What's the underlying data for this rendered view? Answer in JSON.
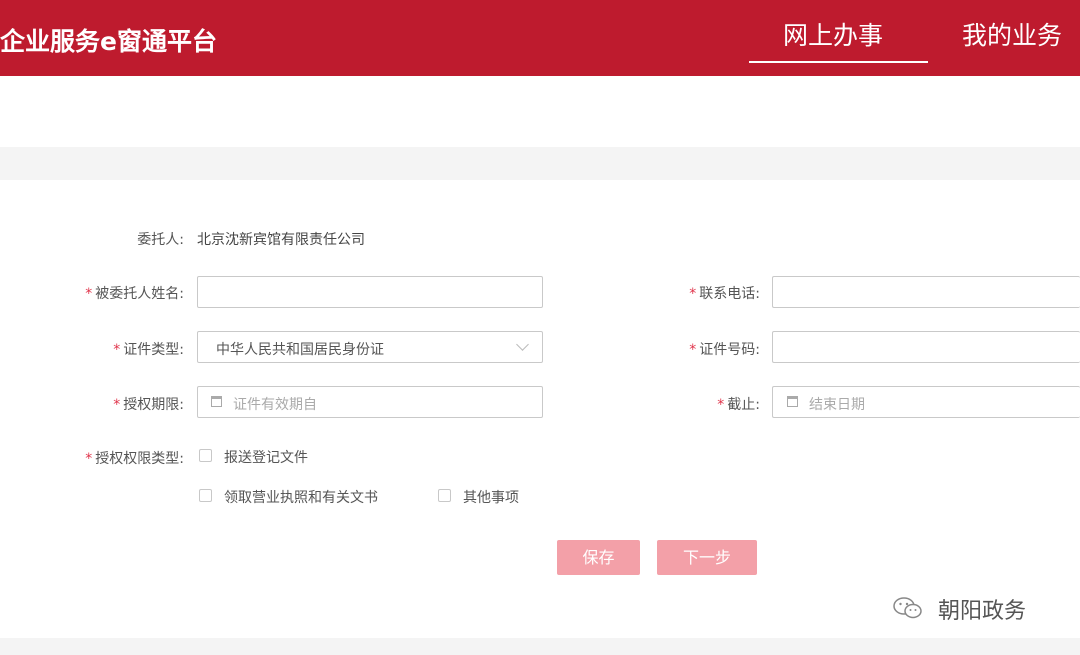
{
  "header": {
    "brand": "企业服务e窗通平台",
    "nav": [
      {
        "label": "网上办事",
        "active": true
      },
      {
        "label": "我的业务",
        "active": false
      }
    ]
  },
  "form": {
    "principal": {
      "label": "委托人:",
      "value": "北京沈新宾馆有限责任公司"
    },
    "agent_name": {
      "label": "被委托人姓名:",
      "value": "",
      "required": true
    },
    "phone": {
      "label": "联系电话:",
      "value": "",
      "required": true
    },
    "id_type": {
      "label": "证件类型:",
      "value": "中华人民共和国居民身份证",
      "required": true
    },
    "id_number": {
      "label": "证件号码:",
      "value": "",
      "required": true
    },
    "period": {
      "label": "授权期限:",
      "placeholder": "证件有效期自",
      "required": true
    },
    "until": {
      "label": "截止:",
      "placeholder": "结束日期",
      "required": true
    },
    "scope": {
      "label": "授权权限类型:",
      "required": true,
      "options": [
        {
          "label": "报送登记文件",
          "checked": false
        },
        {
          "label": "领取营业执照和有关文书",
          "checked": false
        },
        {
          "label": "其他事项",
          "checked": false
        }
      ]
    },
    "required_mark": "*"
  },
  "buttons": {
    "save": "保存",
    "next": "下一步"
  },
  "watermark": "朝阳政务",
  "colors": {
    "brand_red": "#be1b2e",
    "button_pink": "#f3a0a8",
    "required": "#e0334a"
  }
}
